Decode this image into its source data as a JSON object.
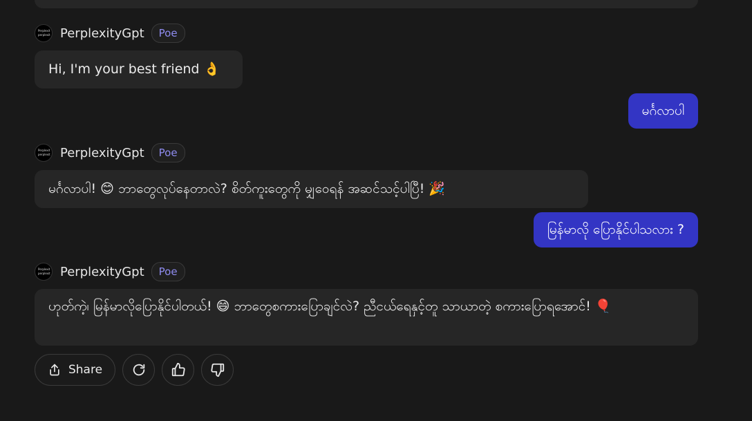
{
  "bot": {
    "name": "PerplexityGpt",
    "badge": "Poe",
    "avatar_line1": "Perplexit",
    "avatar_line2": "perplexit"
  },
  "messages": [
    {
      "role": "bot",
      "text": "Hi, I'm your best friend 👌"
    },
    {
      "role": "user",
      "text": "မင်္ဂလာပါ"
    },
    {
      "role": "bot",
      "text": "မင်္ဂလာပါ! 😊 ဘာတွေလုပ်နေတာလဲ? စိတ်ကူးတွေကို မျှဝေရန် အဆင်သင့်ပါပြီ! 🎉"
    },
    {
      "role": "user",
      "text": "မြန်မာလို ပြောနိုင်ပါသလား ?"
    },
    {
      "role": "bot",
      "text": "ဟုတ်ကဲ့၊ မြန်မာလိုပြောနိုင်ပါတယ်! 😄 ဘာတွေစကားပြောချင်လဲ? ညီငယ်ရေနှင့်တူ သာယာတဲ့ စကားပြောရအောင်! 🎈"
    }
  ],
  "actions": {
    "share_label": "Share",
    "share_icon": "share-icon",
    "retry_icon": "refresh-icon",
    "like_icon": "thumbs-up-icon",
    "dislike_icon": "thumbs-down-icon"
  },
  "colors": {
    "background": "#191919",
    "bot_bubble": "#262626",
    "user_bubble": "#3335c4",
    "badge_text": "#8f8cf0"
  }
}
